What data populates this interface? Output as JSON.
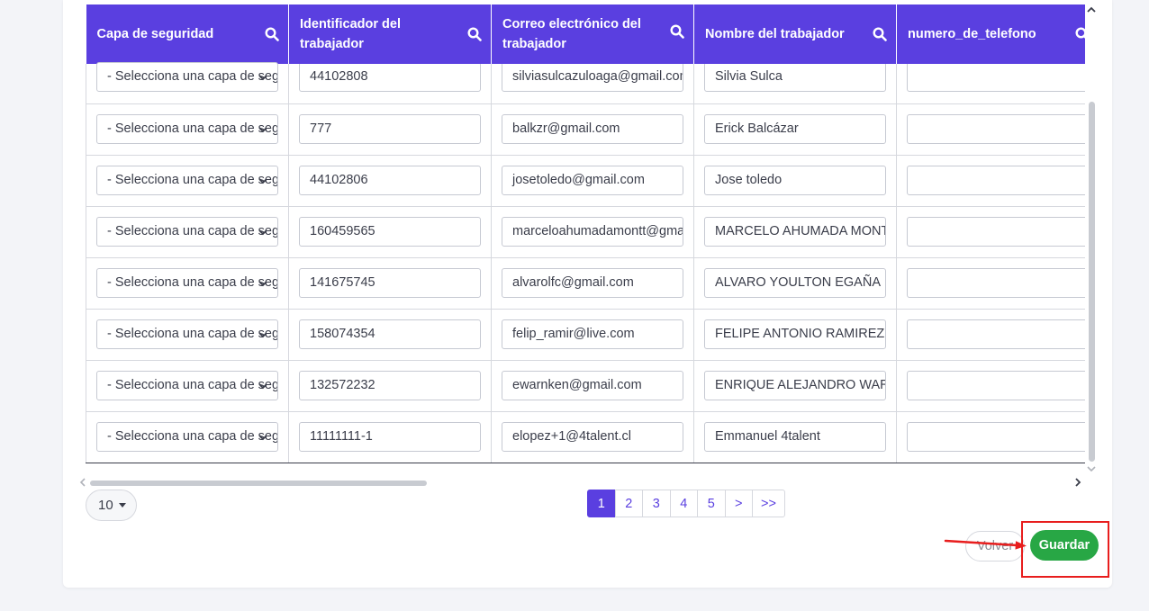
{
  "table": {
    "columns": [
      {
        "label": "Capa de seguridad"
      },
      {
        "label": "Identificador del trabajador"
      },
      {
        "label": "Correo electrónico del trabajador"
      },
      {
        "label": "Nombre del trabajador"
      },
      {
        "label": "numero_de_telefono"
      }
    ],
    "rows": [
      {
        "capa": "- Selecciona una capa de seguridad -",
        "id": "44102808",
        "email": "silviasulcazuloaga@gmail.com",
        "name": "Silvia Sulca",
        "phone": ""
      },
      {
        "capa": "- Selecciona una capa de seguridad -",
        "id": "777",
        "email": "balkzr@gmail.com",
        "name": "Erick Balcázar",
        "phone": ""
      },
      {
        "capa": "- Selecciona una capa de seguridad -",
        "id": "44102806",
        "email": "josetoledo@gmail.com",
        "name": "Jose toledo",
        "phone": ""
      },
      {
        "capa": "- Selecciona una capa de seguridad -",
        "id": "160459565",
        "email": "marceloahumadamontt@gmail.com",
        "name": "MARCELO AHUMADA MONTT",
        "phone": ""
      },
      {
        "capa": "- Selecciona una capa de seguridad -",
        "id": "141675745",
        "email": "alvarolfc@gmail.com",
        "name": "ALVARO YOULTON EGAÑA",
        "phone": ""
      },
      {
        "capa": "- Selecciona una capa de seguridad -",
        "id": "158074354",
        "email": "felip_ramir@live.com",
        "name": "FELIPE ANTONIO RAMIREZ",
        "phone": ""
      },
      {
        "capa": "- Selecciona una capa de seguridad -",
        "id": "132572232",
        "email": "ewarnken@gmail.com",
        "name": "ENRIQUE ALEJANDRO WARNKEN",
        "phone": ""
      },
      {
        "capa": "- Selecciona una capa de seguridad -",
        "id": "11111111-1",
        "email": "elopez+1@4talent.cl",
        "name": "Emmanuel 4talent",
        "phone": ""
      }
    ]
  },
  "pagination": {
    "page_size": "10",
    "pages": [
      "1",
      "2",
      "3",
      "4",
      "5",
      ">",
      ">>"
    ],
    "current": "1"
  },
  "actions": {
    "back_label": "Volver",
    "save_label": "Guardar"
  },
  "colors": {
    "header_bg": "#5a3fe0",
    "save_bg": "#28a745",
    "annotation": "#e81d1d"
  },
  "icons": {
    "column_search": "search-icon",
    "select_toggle": "chevron-down-icon"
  }
}
